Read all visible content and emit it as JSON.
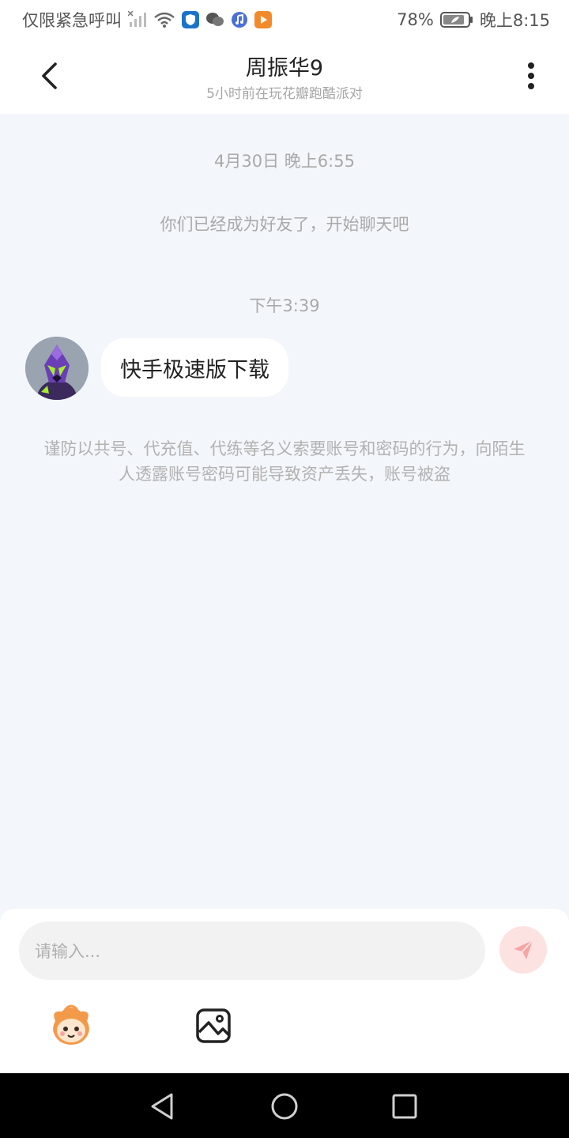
{
  "status_bar": {
    "carrier_text": "仅限紧急呼叫",
    "battery_percent": "78%",
    "time": "晚上8:15",
    "icons": [
      "signal-icon",
      "wifi-icon",
      "shield-app-icon",
      "wechat-icon",
      "music-app-icon",
      "video-app-icon",
      "battery-icon"
    ]
  },
  "header": {
    "title": "周振华9",
    "subtitle": "5小时前在玩花瓣跑酷派对",
    "back_icon": "back-chevron-icon",
    "more_icon": "more-vertical-icon"
  },
  "chat": {
    "timestamp_1": "4月30日 晚上6:55",
    "system_message": "你们已经成为好友了，开始聊天吧",
    "timestamp_2": "下午3:39",
    "messages": [
      {
        "sender": "friend",
        "text": "快手极速版下载"
      }
    ],
    "warning": "谨防以共号、代充值、代练等名义索要账号和密码的行为，向陌生人透露账号密码可能导致资产丢失，账号被盗"
  },
  "composer": {
    "placeholder": "请输入...",
    "send_icon": "send-icon",
    "emoji_icon": "emoji-sticker-icon",
    "image_icon": "image-icon"
  },
  "colors": {
    "chat_background": "#f3f6fa",
    "send_button": "#fde2e2",
    "send_arrow": "#f5a5a5"
  },
  "nav_bar": {
    "icons": [
      "nav-back-icon",
      "nav-home-icon",
      "nav-recents-icon"
    ]
  }
}
